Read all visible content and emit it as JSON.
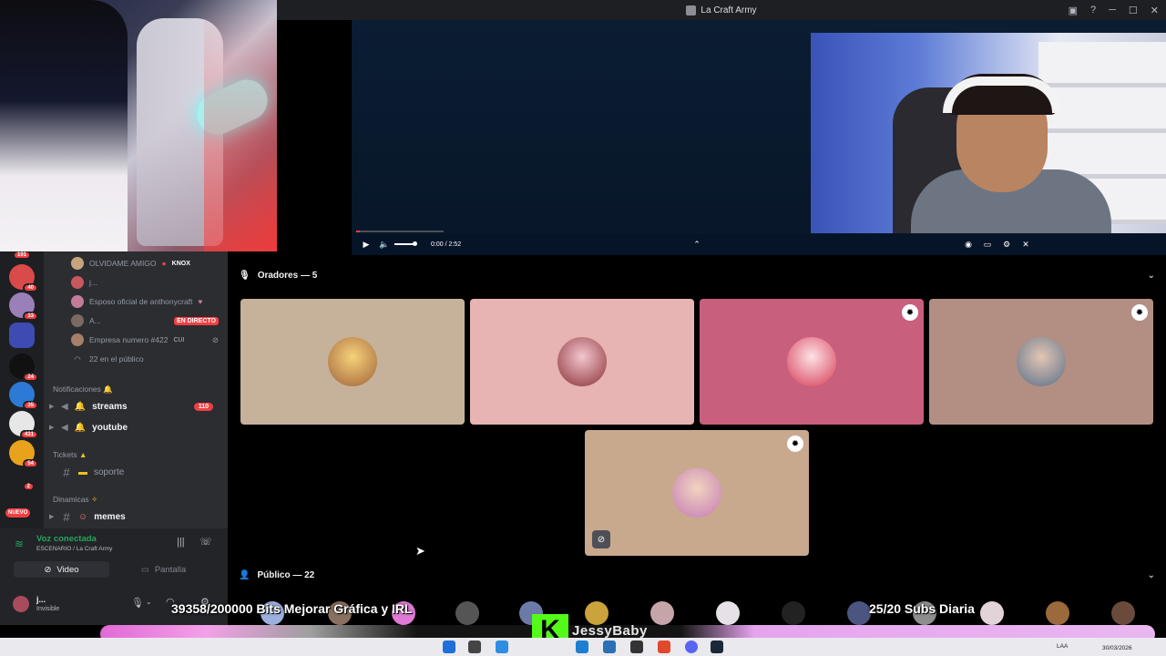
{
  "window": {
    "title": "La Craft Army"
  },
  "player": {
    "time": "0:00 / 2:52"
  },
  "rail": {
    "top_badge": "191",
    "nuevo": "NUEVO",
    "badges": [
      "40",
      "33",
      "24",
      "35",
      "431",
      "54",
      "2"
    ]
  },
  "voice_users": [
    {
      "name": "OLVIDAME AMIGO",
      "tag": "KNOX"
    },
    {
      "name": "j..."
    },
    {
      "name": "Esposo oficial de anthonycraft"
    },
    {
      "name": "A...",
      "tag": "EN DIRECTO"
    },
    {
      "name": "Empresa numero #422",
      "tag": "CUI"
    }
  ],
  "public_count_text": "22 en el público",
  "categories": {
    "notificaciones": "Notificaciones",
    "tickets": "Tickets",
    "dinamicas": "Dinamicas"
  },
  "channels": {
    "streams": {
      "name": "streams",
      "badge": "110"
    },
    "youtube": {
      "name": "youtube"
    },
    "soporte": {
      "name": "soporte"
    },
    "memes": {
      "name": "memes"
    }
  },
  "voice_panel": {
    "status": "Voz conectada",
    "sub": "ESCENARIO / La Craft Army",
    "video_label": "Video",
    "screen_label": "Pantalla"
  },
  "user": {
    "name": "j...",
    "status": "Invisible"
  },
  "stage": {
    "speakers_header": "Oradores — 5",
    "audience_header": "Público — 22"
  },
  "overlays": {
    "bits_goal": "39358/200000 Bits Mejorar Gráfica y IRL",
    "subs_goal": "25/20 Subs Diaria",
    "brand": "JessyBaby"
  },
  "colors": {
    "live_red": "#f23f43",
    "voice_green": "#23a55a",
    "kick_green": "#53fc18"
  },
  "taskbar": {
    "lang": "LAA",
    "date": "30/03/2026"
  }
}
